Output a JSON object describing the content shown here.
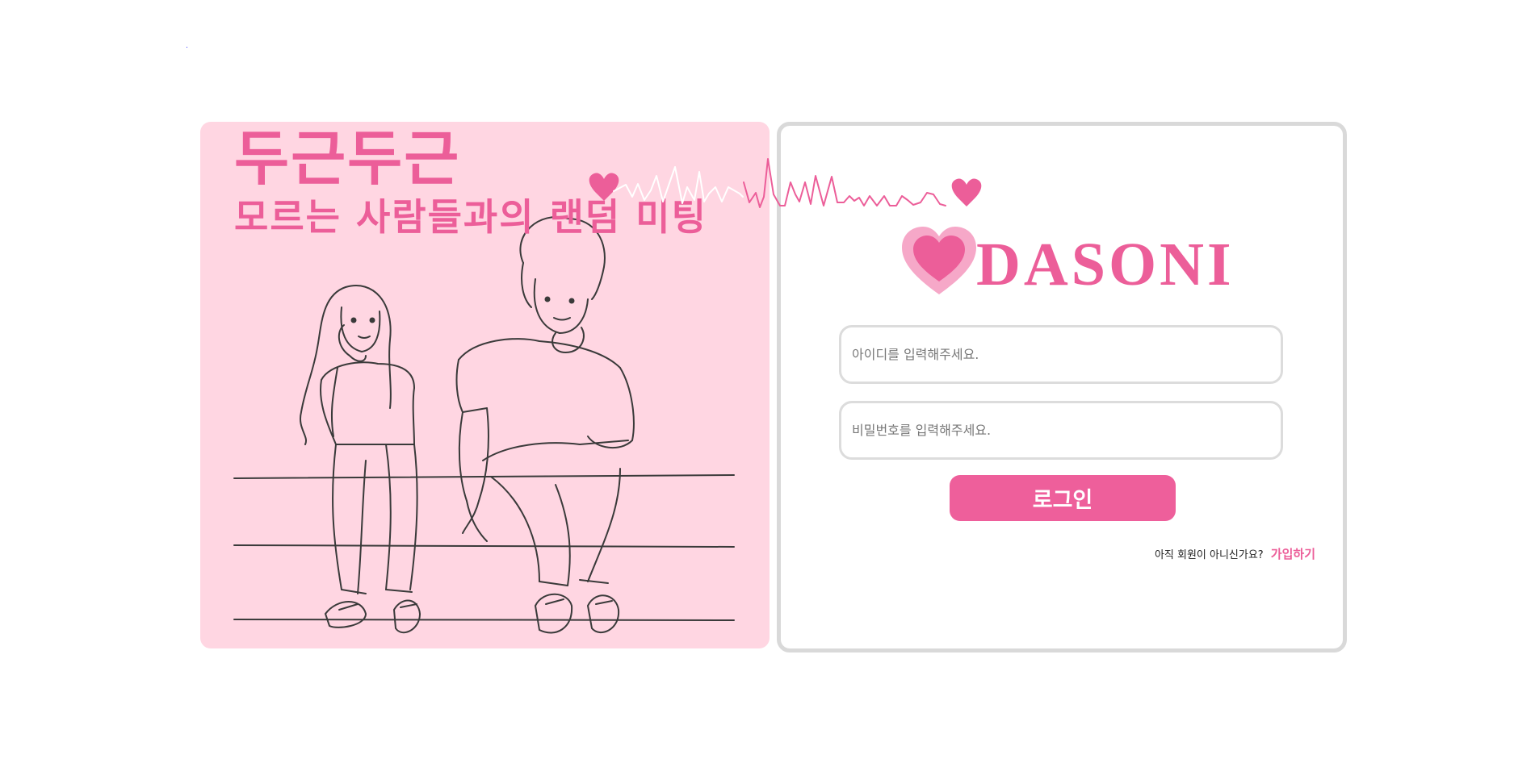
{
  "hero": {
    "title": "두근두근",
    "subtitle": "모르는 사람들과의 랜덤 미팅",
    "illustration_icon": "couple-sitting-illustration"
  },
  "brand": {
    "logo_text": "DASONI",
    "logo_icon": "heart-icon",
    "heartbeat_icon": "heartbeat-line-icon"
  },
  "login": {
    "id_placeholder": "아이디를 입력해주세요.",
    "pw_placeholder": "비밀번호를 입력해주세요.",
    "submit_label": "로그인",
    "signup_question": "아직 회원이 아니신가요?",
    "signup_link": "가입하기"
  },
  "colors": {
    "accent": "#ec5e99",
    "panel_pink": "#ffd6e2",
    "border_gray": "#d9d9d9",
    "heart_light": "#f6a8c8"
  }
}
